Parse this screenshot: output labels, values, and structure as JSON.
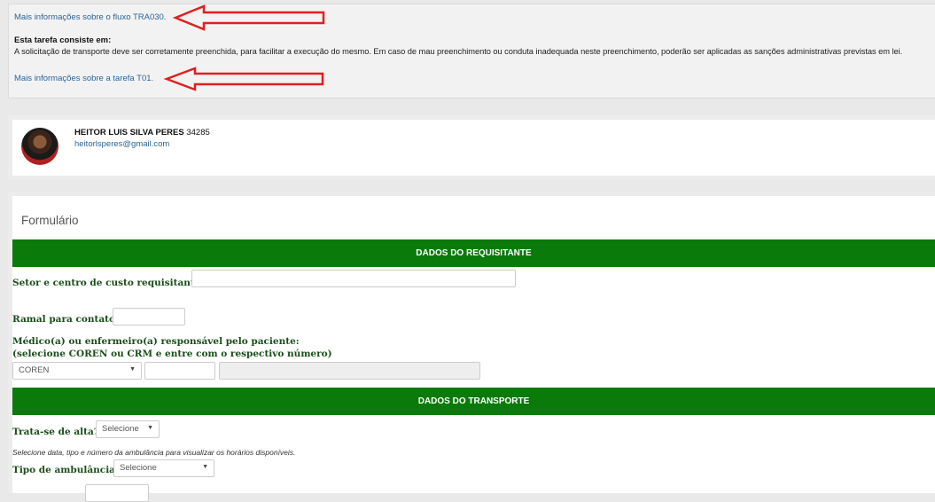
{
  "info": {
    "flow_link": "Mais informações sobre o fluxo TRA030.",
    "task_title": "Esta tarefa consiste em:",
    "task_desc": "A solicitação de transporte deve ser corretamente preenchida, para facilitar a execução do mesmo. Em caso de mau preenchimento ou conduta inadequada neste preenchimento, poderão ser aplicadas as sanções administrativas previstas em lei.",
    "task_link": "Mais informações sobre a tarefa T01.",
    "arrow_color": "#e02020"
  },
  "user": {
    "name": "HEITOR LUIS SILVA PERES",
    "id": "34285",
    "email": "heitorlsperes@gmail.com"
  },
  "form": {
    "title": "Formulário",
    "header_color": "#0a7a0a",
    "section1": "DADOS DO REQUISITANTE",
    "setor_label": "Setor e centro de custo requisitante:",
    "ramal_label": "Ramal para contato:",
    "medico_label_1": "Médico(a) ou enfermeiro(a) responsável pelo paciente:",
    "medico_label_2": "(selecione COREN ou CRM e entre com o respectivo número)",
    "coren_select": "COREN",
    "section2": "DADOS DO TRANSPORTE",
    "alta_label": "Trata-se de alta?",
    "alta_select": "Selecione",
    "hint": "Selecione data, tipo e número da ambulância para visualizar os horários disponíveis.",
    "tipo_label": "Tipo de ambulância:",
    "tipo_select": "Selecione"
  }
}
